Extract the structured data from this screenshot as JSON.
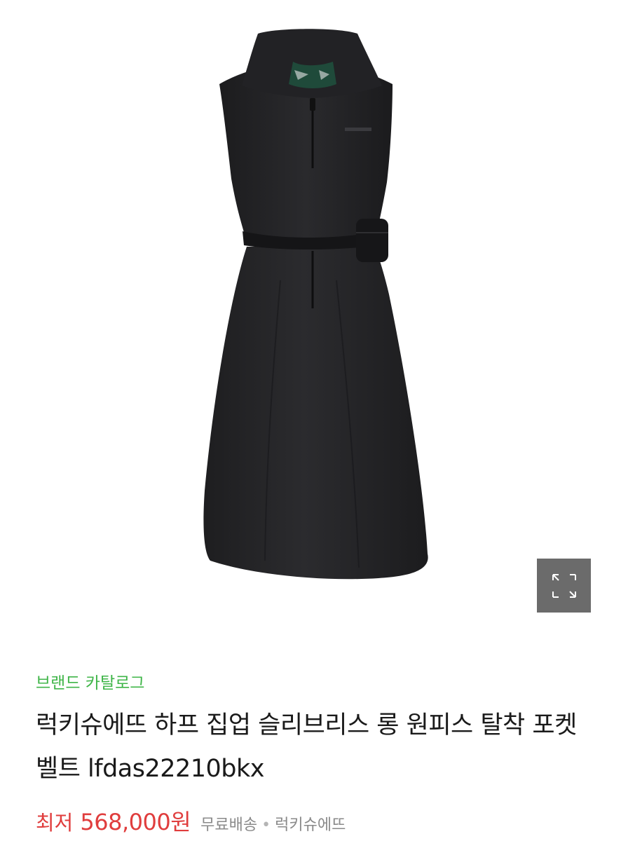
{
  "product_image": {
    "alt": "",
    "icon": "dress-illustration"
  },
  "zoom": {
    "icon": "expand-icon"
  },
  "brand_catalog": {
    "label": "브랜드 카탈로그"
  },
  "product": {
    "title": "럭키슈에뜨 하프 집업 슬리브리스 롱 원피스 탈착 포켓 벨트 lfdas22210bkx"
  },
  "price": {
    "label": "최저",
    "value": "568,000원",
    "shipping": "무료배송",
    "separator": "•",
    "seller": "럭키슈에뜨"
  },
  "colors": {
    "brand_green": "#3fb548",
    "price_red": "#e03d3d",
    "zoom_bg": "#6b6b6b"
  }
}
